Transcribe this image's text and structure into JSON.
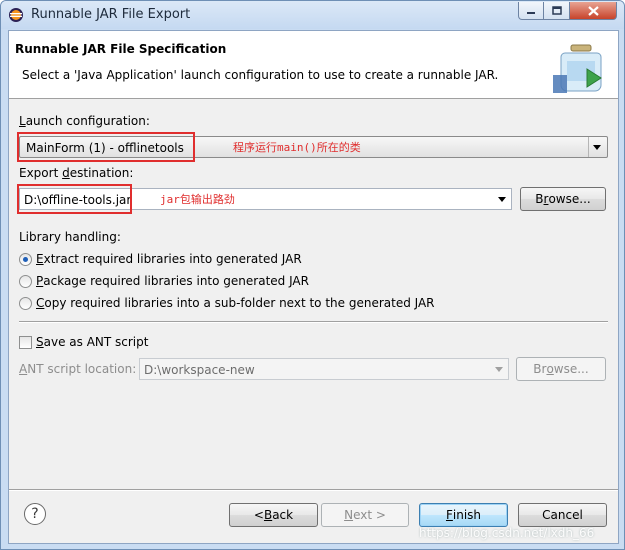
{
  "window": {
    "title": "Runnable JAR File Export"
  },
  "banner": {
    "title": "Runnable JAR File Specification",
    "description": "Select a 'Java Application' launch configuration to use to create a runnable JAR."
  },
  "launch": {
    "label_prefix": "L",
    "label_rest": "aunch configuration:",
    "selected": "MainForm (1) - offlinetools"
  },
  "export": {
    "label_prefix": "Export ",
    "label_accel": "d",
    "label_rest": "estination:",
    "value": "D:\\offline-tools.jar",
    "browse_pre": "B",
    "browse_accel": "r",
    "browse_rest": "owse..."
  },
  "annotations": {
    "launch_note": "程序运行main()所在的类",
    "export_note": "jar包输出路劲",
    "color": "#e02e2e"
  },
  "library": {
    "label": "Library handling:",
    "options": [
      {
        "accel": "E",
        "rest": "xtract required libraries into generated JAR",
        "checked": true
      },
      {
        "accel": "P",
        "rest": "ackage required libraries into generated JAR",
        "checked": false
      },
      {
        "accel": "C",
        "rest": "opy required libraries into a sub-folder next to the generated JAR",
        "checked": false
      }
    ]
  },
  "ant": {
    "checkbox_accel": "S",
    "checkbox_rest": "ave as ANT script",
    "checked": false,
    "location_accel": "A",
    "location_rest": "NT script location:",
    "location_value": "D:\\workspace-new",
    "browse_pre": "Br",
    "browse_accel": "o",
    "browse_rest": "wse..."
  },
  "footer": {
    "help_icon": "question-icon",
    "back_pre": "< ",
    "back_accel": "B",
    "back_rest": "ack",
    "next_accel": "N",
    "next_rest": "ext >",
    "finish_accel": "F",
    "finish_rest": "inish",
    "cancel": "Cancel",
    "watermark": "https://blog.csdn.net/lxdh_66"
  }
}
